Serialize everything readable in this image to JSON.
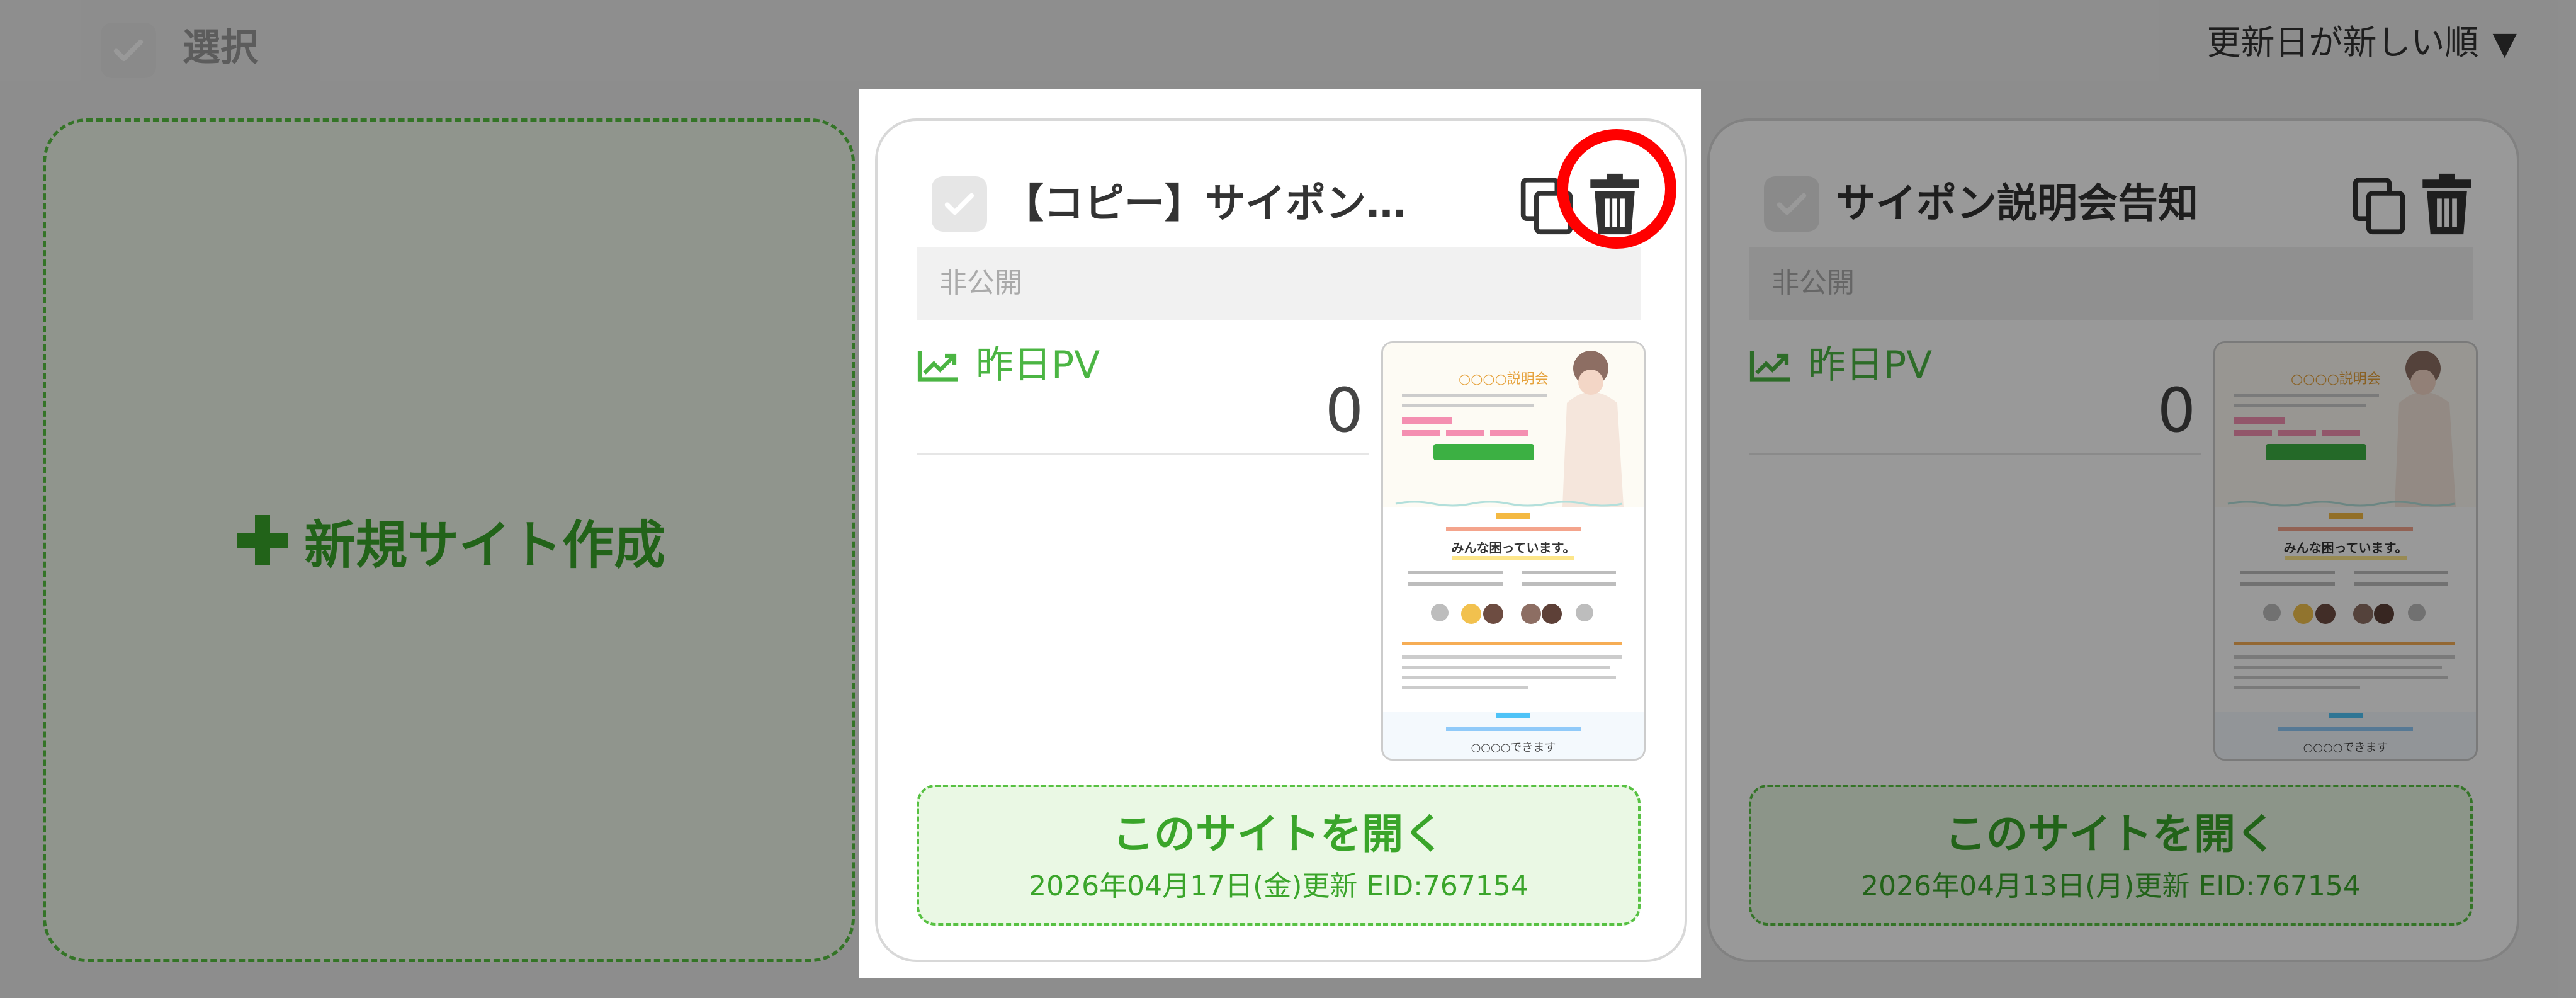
{
  "toolbar": {
    "select_label": "選択",
    "sort_label": "更新日が新しい順",
    "sort_arrow": "▼"
  },
  "new_site": {
    "label": "新規サイト作成",
    "icon": "plus-icon"
  },
  "sites": [
    {
      "title": "【コピー】サイポン説明…",
      "status": "非公開",
      "pv_label": "昨日PV",
      "pv_value": "0",
      "open_label": "このサイトを開く",
      "updated": "2026年04月17日(金)更新 EID:767154",
      "thumbnail": {
        "event_title": "○○○○説明会",
        "problem_heading": "みんな困っています。",
        "footer_text": "○○○○できます"
      }
    },
    {
      "title": "サイポン説明会告知",
      "status": "非公開",
      "pv_label": "昨日PV",
      "pv_value": "0",
      "open_label": "このサイトを開く",
      "updated": "2026年04月13日(月)更新 EID:767154",
      "thumbnail": {
        "event_title": "○○○○説明会",
        "problem_heading": "みんな困っています。",
        "footer_text": "○○○○できます"
      }
    }
  ],
  "colors": {
    "accent_green": "#3aa52a",
    "highlight_red": "#ff0000"
  }
}
